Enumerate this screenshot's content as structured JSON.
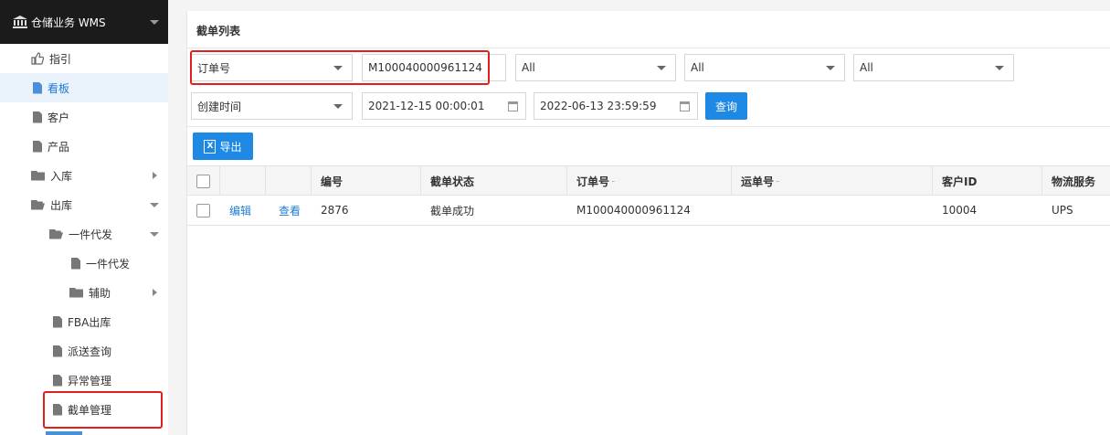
{
  "app": {
    "title": "仓储业务 WMS"
  },
  "sidebar": {
    "items": [
      {
        "label": "指引"
      },
      {
        "label": "看板"
      },
      {
        "label": "客户"
      },
      {
        "label": "产品"
      },
      {
        "label": "入库"
      },
      {
        "label": "出库"
      },
      {
        "label": "一件代发"
      },
      {
        "label": "一件代发"
      },
      {
        "label": "辅助"
      },
      {
        "label": "FBA出库"
      },
      {
        "label": "派送查询"
      },
      {
        "label": "异常管理"
      },
      {
        "label": "截单管理"
      }
    ]
  },
  "panel": {
    "title": "截单列表"
  },
  "filters": {
    "search_field": "订单号",
    "search_value": "M100040000961124",
    "select1": "All",
    "select2": "All",
    "select3": "All",
    "time_field": "创建时间",
    "date_from": "2021-12-15 00:00:01",
    "date_to": "2022-06-13 23:59:59",
    "query_label": "查询"
  },
  "toolbar": {
    "export_label": "导出",
    "export_icon": "X"
  },
  "table": {
    "headers": [
      "编号",
      "截单状态",
      "订单号",
      "运单号",
      "客户ID",
      "物流服务"
    ],
    "rows": [
      {
        "edit": "编辑",
        "view": "查看",
        "id": "2876",
        "status": "截单成功",
        "order_no": "M100040000961124",
        "waybill_no": "",
        "customer_id": "10004",
        "service": "UPS"
      }
    ]
  },
  "colors": {
    "accent": "#1e88e5",
    "highlight": "#e02020",
    "header_bg": "#1b1b1b"
  }
}
